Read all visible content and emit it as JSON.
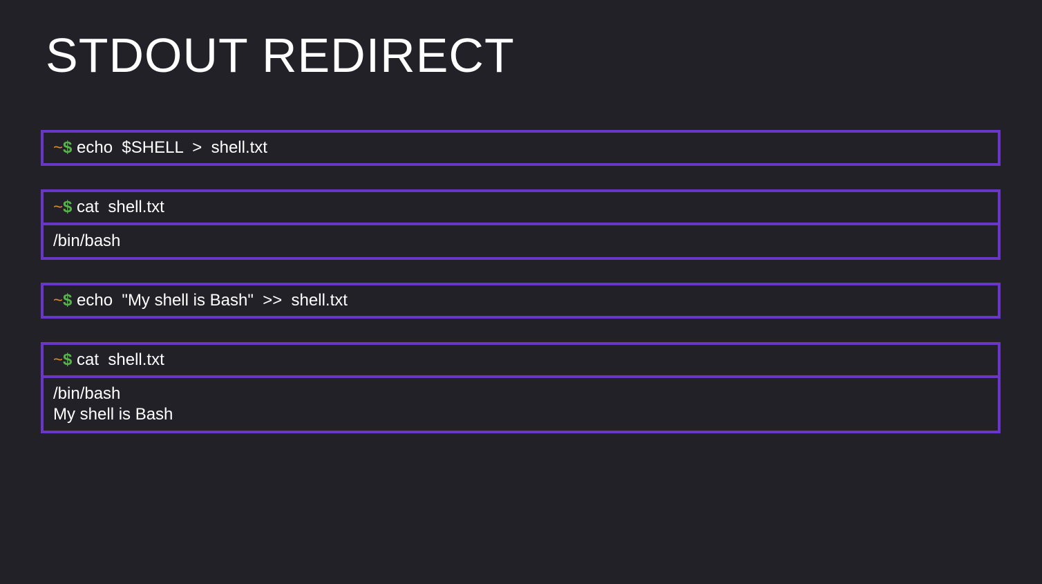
{
  "slide": {
    "title": "STDOUT REDIRECT"
  },
  "colors": {
    "background": "#222128",
    "border": "#6a35c9",
    "prompt_tilde": "#e08a2c",
    "prompt_dollar": "#56b54a",
    "text": "#ffffff"
  },
  "prompt": {
    "tilde": "~",
    "dollar": "$"
  },
  "blocks": [
    {
      "command": " echo  $SHELL  >  shell.txt",
      "output": []
    },
    {
      "command": " cat  shell.txt",
      "output": [
        "/bin/bash"
      ]
    },
    {
      "command": " echo  \"My shell is Bash\"  >>  shell.txt",
      "output": []
    },
    {
      "command": " cat  shell.txt",
      "output": [
        "/bin/bash",
        "My shell is Bash"
      ]
    }
  ]
}
